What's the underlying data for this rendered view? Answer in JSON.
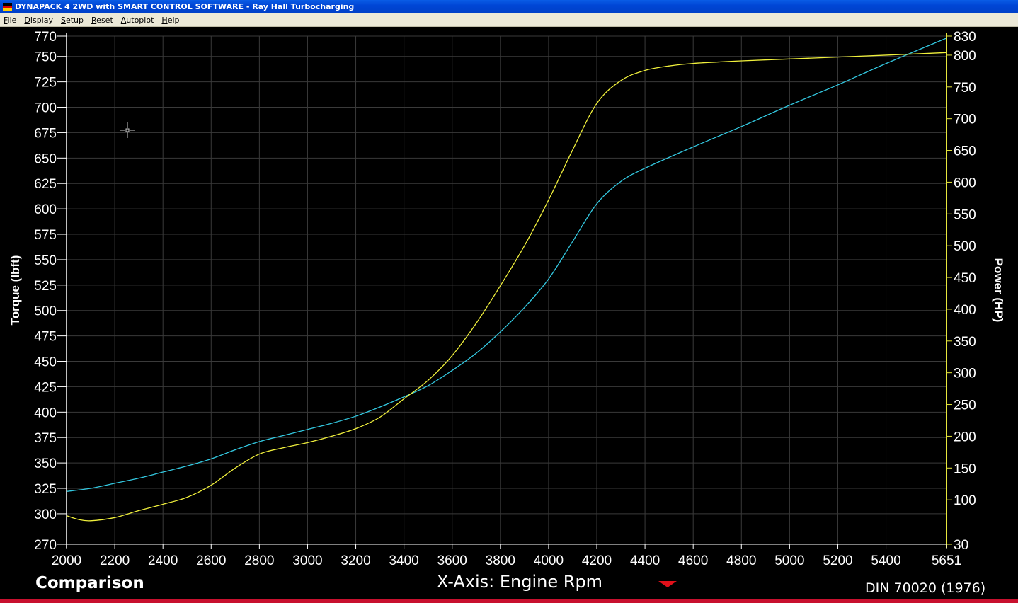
{
  "window": {
    "title": "DYNAPACK 4 2WD with SMART CONTROL SOFTWARE - Ray Hall Turbocharging"
  },
  "menu": {
    "items": [
      {
        "label": "File",
        "underline": "F",
        "rest": "ile"
      },
      {
        "label": "Display",
        "underline": "D",
        "rest": "isplay"
      },
      {
        "label": "Setup",
        "underline": "S",
        "rest": "etup"
      },
      {
        "label": "Reset",
        "underline": "R",
        "rest": "eset"
      },
      {
        "label": "Autoplot",
        "underline": "A",
        "rest": "utoplot"
      },
      {
        "label": "Help",
        "underline": "H",
        "rest": "elp"
      }
    ]
  },
  "footer": {
    "mode": "Comparison",
    "x_axis_label": "X-Axis: Engine Rpm",
    "standard": "DIN 70020 (1976)"
  },
  "colors": {
    "background": "#000000",
    "grid": "#3a3a3a",
    "torque_line": "#33c8e0",
    "power_line": "#f0f03c",
    "power_axis": "#e6e63c"
  },
  "chart_data": {
    "type": "line",
    "xlabel": "",
    "x_ticks": [
      2000,
      2200,
      2400,
      2600,
      2800,
      3000,
      3200,
      3400,
      3600,
      3800,
      4000,
      4200,
      4400,
      4600,
      4800,
      5000,
      5200,
      5400,
      5651
    ],
    "xlim": [
      2000,
      5651
    ],
    "y_left": {
      "label": "Torque (lbft)",
      "ticks": [
        270,
        300,
        325,
        350,
        375,
        400,
        425,
        450,
        475,
        500,
        525,
        550,
        575,
        600,
        625,
        650,
        675,
        700,
        725,
        750,
        770
      ],
      "range": [
        270,
        770
      ]
    },
    "y_right": {
      "label": "Power (HP)",
      "ticks": [
        30,
        100,
        150,
        200,
        250,
        300,
        350,
        400,
        450,
        500,
        550,
        600,
        650,
        700,
        750,
        800,
        830
      ],
      "range": [
        30,
        830
      ]
    },
    "grid": true,
    "series": [
      {
        "axis": "left",
        "color": "#33c8e0",
        "x": [
          2000,
          2100,
          2200,
          2300,
          2400,
          2500,
          2600,
          2700,
          2800,
          2900,
          3000,
          3100,
          3200,
          3300,
          3400,
          3500,
          3600,
          3700,
          3800,
          3900,
          4000,
          4100,
          4200,
          4300,
          4400,
          4600,
          4800,
          5000,
          5200,
          5400,
          5651
        ],
        "y": [
          322,
          325,
          330,
          335,
          341,
          347,
          354,
          363,
          371,
          377,
          383,
          389,
          396,
          405,
          415,
          426,
          441,
          458,
          479,
          503,
          531,
          568,
          605,
          627,
          640,
          661,
          681,
          702,
          722,
          743,
          768
        ]
      },
      {
        "axis": "right",
        "color": "#f0f03c",
        "x": [
          2000,
          2050,
          2100,
          2200,
          2300,
          2400,
          2500,
          2600,
          2700,
          2800,
          2900,
          3000,
          3100,
          3200,
          3300,
          3400,
          3500,
          3600,
          3700,
          3800,
          3900,
          4000,
          4100,
          4200,
          4300,
          4400,
          4500,
          4600,
          4800,
          5000,
          5200,
          5400,
          5651
        ],
        "y": [
          75,
          69,
          67,
          72,
          83,
          93,
          104,
          123,
          150,
          172,
          182,
          190,
          200,
          212,
          230,
          259,
          288,
          327,
          378,
          437,
          500,
          572,
          651,
          724,
          760,
          776,
          783,
          787,
          791,
          794,
          797,
          800,
          804
        ]
      }
    ]
  }
}
